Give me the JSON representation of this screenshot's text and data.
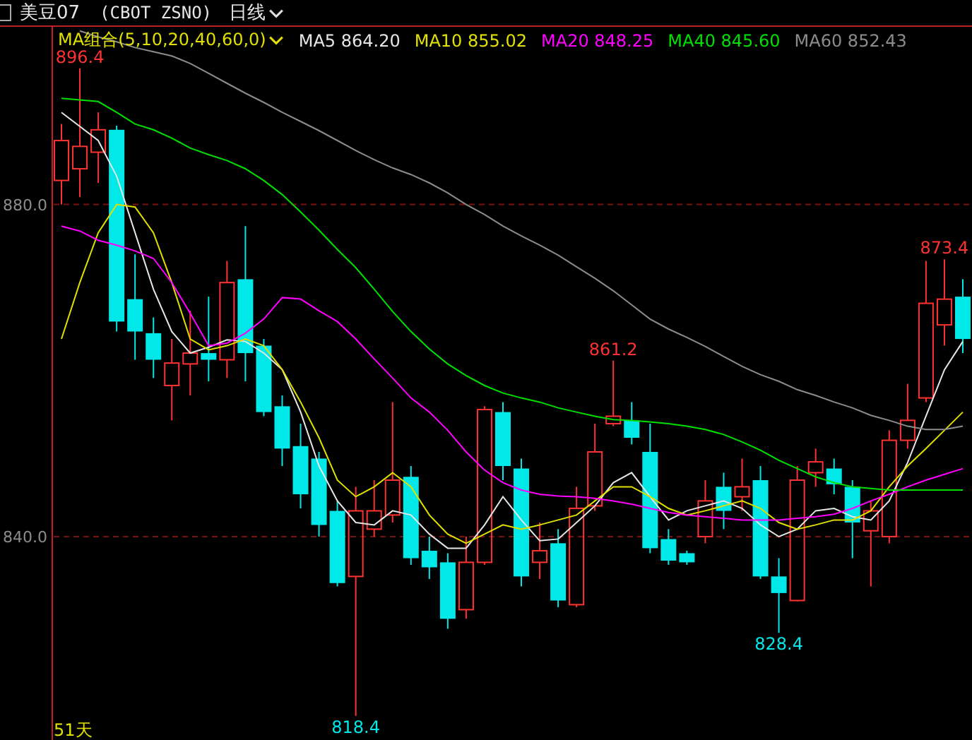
{
  "header": {
    "symbol": "美豆07",
    "code": "(CBOT ZSNO)",
    "period": "日线"
  },
  "indicator": {
    "label": "MA组合(5,10,20,40,60,0)",
    "items": [
      {
        "value": "864.20"
      },
      {
        "value": "855.02"
      },
      {
        "value": "848.25"
      },
      {
        "value": "845.60"
      },
      {
        "value": "852.43"
      }
    ]
  },
  "chart_data": {
    "type": "candlestick",
    "ylim": [
      815.5,
      901.4
    ],
    "categories": [
      null,
      null,
      null,
      null,
      null,
      null,
      null,
      null,
      null,
      null,
      null,
      null,
      null,
      null,
      null,
      null,
      null,
      null,
      null,
      null,
      null,
      null,
      null,
      null,
      null,
      null,
      null,
      null,
      null,
      null,
      null,
      null,
      null,
      null,
      null,
      null,
      null,
      null,
      null,
      null,
      null,
      null,
      null,
      null,
      null,
      null,
      null,
      null,
      null,
      null
    ],
    "yticks": [
      {
        "value": 880,
        "label": "880.0"
      },
      {
        "value": 840,
        "label": "840.0"
      }
    ],
    "ohlc": [
      [
        882.9,
        889.7,
        880.0,
        887.7
      ],
      [
        884.3,
        896.4,
        880.9,
        887.0
      ],
      [
        886.3,
        891.1,
        882.6,
        889.0
      ],
      [
        889.0,
        889.5,
        864.7,
        865.9
      ],
      [
        868.6,
        874.0,
        861.3,
        864.7
      ],
      [
        864.5,
        866.4,
        859.1,
        861.3
      ],
      [
        858.2,
        863.8,
        854.0,
        860.9
      ],
      [
        860.8,
        867.2,
        857.0,
        862.1
      ],
      [
        862.1,
        868.9,
        858.7,
        861.3
      ],
      [
        861.3,
        873.2,
        859.1,
        870.6
      ],
      [
        871.0,
        877.4,
        858.7,
        862.1
      ],
      [
        863.0,
        863.8,
        854.5,
        855.0
      ],
      [
        855.7,
        857.0,
        848.5,
        850.6
      ],
      [
        850.9,
        853.6,
        843.4,
        845.1
      ],
      [
        849.4,
        850.2,
        840.0,
        841.4
      ],
      [
        843.1,
        844.3,
        834.0,
        834.4
      ],
      [
        835.2,
        846.0,
        818.4,
        843.1
      ],
      [
        840.9,
        846.8,
        840.0,
        843.1
      ],
      [
        842.6,
        856.2,
        841.7,
        846.8
      ],
      [
        847.2,
        848.5,
        836.6,
        837.4
      ],
      [
        838.3,
        840.0,
        834.9,
        836.3
      ],
      [
        836.9,
        838.0,
        828.9,
        830.1
      ],
      [
        831.2,
        840.0,
        830.1,
        836.9
      ],
      [
        836.9,
        855.7,
        836.6,
        855.3
      ],
      [
        855.0,
        856.2,
        846.8,
        848.5
      ],
      [
        848.2,
        849.4,
        834.0,
        835.2
      ],
      [
        836.9,
        841.7,
        834.9,
        838.3
      ],
      [
        839.2,
        840.9,
        831.5,
        832.3
      ],
      [
        831.8,
        846.0,
        831.5,
        843.4
      ],
      [
        843.7,
        853.6,
        843.1,
        850.2
      ],
      [
        853.6,
        861.2,
        853.3,
        854.5
      ],
      [
        854.0,
        856.2,
        851.1,
        851.9
      ],
      [
        850.2,
        853.6,
        838.0,
        838.6
      ],
      [
        839.7,
        840.9,
        836.6,
        837.1
      ],
      [
        838.0,
        838.3,
        836.6,
        836.9
      ],
      [
        840.0,
        846.8,
        839.2,
        844.3
      ],
      [
        846.0,
        847.7,
        840.9,
        843.1
      ],
      [
        844.8,
        849.4,
        843.1,
        846.0
      ],
      [
        846.8,
        848.5,
        834.9,
        835.2
      ],
      [
        835.2,
        837.4,
        828.4,
        833.2
      ],
      [
        832.3,
        848.5,
        832.2,
        846.8
      ],
      [
        847.7,
        850.6,
        846.0,
        849.0
      ],
      [
        848.2,
        849.4,
        845.1,
        846.3
      ],
      [
        846.0,
        846.8,
        837.4,
        841.7
      ],
      [
        840.7,
        844.3,
        834.0,
        843.1
      ],
      [
        840.0,
        852.8,
        839.2,
        851.6
      ],
      [
        851.6,
        858.4,
        850.6,
        854.0
      ],
      [
        856.7,
        873.2,
        856.2,
        868.1
      ],
      [
        865.5,
        873.4,
        863.0,
        868.6
      ],
      [
        868.9,
        871.0,
        862.1,
        863.8
      ]
    ],
    "series": [
      {
        "name": "MA5",
        "type": "line",
        "color": "#e6e6e6",
        "values": [
          891.1,
          889.4,
          887.7,
          883.4,
          876.6,
          869.8,
          864.7,
          862.1,
          862.8,
          863.7,
          863.5,
          862.1,
          860.1,
          855.0,
          848.5,
          844.3,
          841.7,
          841.4,
          843.1,
          842.6,
          840.3,
          838.6,
          838.6,
          841.4,
          844.8,
          842.0,
          839.5,
          839.7,
          841.7,
          843.7,
          846.5,
          847.7,
          844.8,
          842.0,
          843.1,
          843.7,
          844.3,
          843.4,
          841.4,
          840.0,
          840.9,
          843.1,
          843.4,
          842.4,
          842.0,
          844.3,
          848.9,
          854.5,
          860.1,
          863.5
        ]
      },
      {
        "name": "MA10",
        "type": "line",
        "color": "#e0e000",
        "values": [
          863.8,
          870.6,
          876.6,
          880.0,
          879.7,
          876.6,
          870.6,
          863.8,
          862.5,
          863.0,
          863.8,
          863.0,
          860.1,
          856.2,
          851.9,
          846.8,
          844.8,
          846.0,
          847.7,
          846.0,
          842.6,
          840.3,
          839.2,
          840.3,
          841.4,
          840.9,
          841.4,
          842.0,
          842.6,
          844.3,
          846.0,
          846.0,
          844.8,
          843.4,
          842.6,
          843.1,
          843.7,
          844.3,
          843.4,
          841.7,
          840.9,
          841.4,
          842.0,
          842.0,
          843.1,
          846.0,
          848.5,
          850.6,
          852.8,
          855.0
        ]
      },
      {
        "name": "MA20",
        "type": "line",
        "color": "#ff00ff",
        "values": [
          877.4,
          876.8,
          875.7,
          875.1,
          874.4,
          873.5,
          870.6,
          866.9,
          863.0,
          863.3,
          864.5,
          866.2,
          868.8,
          868.6,
          867.2,
          865.9,
          863.8,
          861.4,
          859.1,
          856.7,
          855.0,
          852.8,
          850.2,
          848.0,
          846.5,
          845.6,
          845.1,
          844.9,
          844.8,
          844.6,
          844.3,
          843.9,
          843.4,
          842.9,
          842.6,
          842.4,
          842.2,
          842.0,
          842.0,
          842.0,
          842.2,
          842.4,
          842.7,
          843.4,
          844.3,
          845.1,
          846.0,
          846.8,
          847.5,
          848.2
        ]
      },
      {
        "name": "MA40",
        "type": "line",
        "color": "#00e000",
        "values": [
          892.8,
          892.6,
          892.4,
          891.1,
          889.7,
          889.0,
          888.0,
          886.8,
          886.0,
          885.3,
          884.3,
          882.9,
          881.2,
          879.1,
          876.9,
          874.6,
          872.4,
          869.8,
          867.1,
          864.7,
          862.6,
          860.8,
          859.4,
          858.2,
          857.3,
          856.7,
          856.2,
          855.5,
          855.0,
          854.5,
          854.1,
          854.0,
          853.8,
          853.6,
          853.3,
          852.9,
          852.3,
          851.4,
          850.4,
          849.2,
          848.2,
          847.2,
          846.5,
          846.0,
          845.8,
          845.6,
          845.6,
          845.6,
          845.6,
          845.6
        ]
      },
      {
        "name": "MA60",
        "type": "line",
        "color": "#8c8c8c",
        "values": [
          null,
          900.9,
          900.2,
          899.6,
          898.9,
          898.4,
          897.9,
          897.0,
          895.8,
          894.6,
          893.4,
          892.3,
          891.1,
          890.0,
          888.9,
          887.7,
          886.5,
          885.4,
          884.4,
          883.6,
          882.6,
          881.4,
          880.0,
          878.8,
          877.4,
          876.2,
          875.1,
          873.9,
          872.5,
          871.1,
          869.6,
          867.9,
          866.2,
          865.0,
          864.0,
          862.9,
          861.7,
          860.5,
          859.5,
          858.7,
          857.7,
          857.0,
          856.2,
          855.5,
          854.6,
          854.0,
          853.3,
          852.9,
          852.9,
          853.3
        ]
      }
    ],
    "annotations": [
      {
        "y": 896.4,
        "text": "896.4"
      },
      {
        "y": 861.2,
        "text": "861.2"
      },
      {
        "y": 873.4,
        "text": "873.4"
      },
      {
        "y": 828.4,
        "text": "828.4"
      },
      {
        "y": 818.4,
        "text": "818.4"
      }
    ]
  },
  "footer": {
    "count": "51天"
  }
}
